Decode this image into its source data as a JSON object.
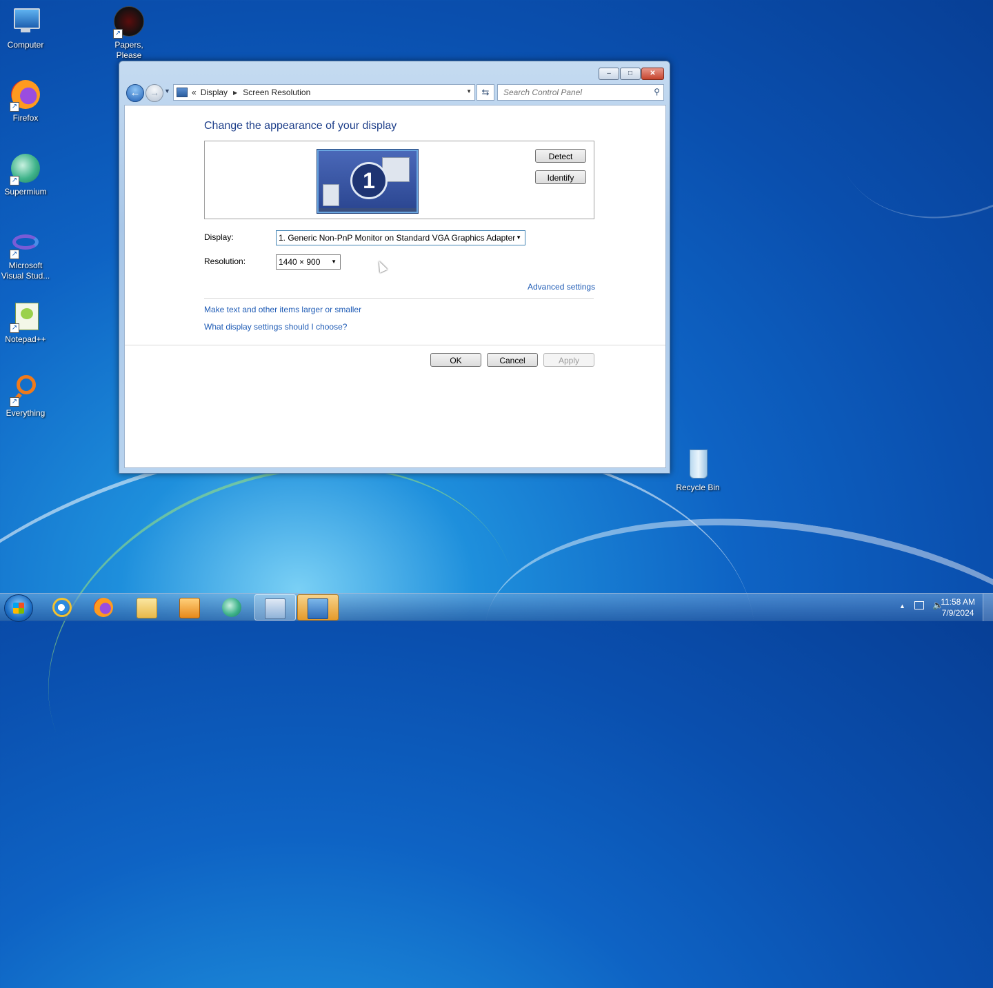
{
  "desktop": {
    "icons": [
      {
        "label": "Computer"
      },
      {
        "label": "Papers, Please"
      },
      {
        "label": "Firefox"
      },
      {
        "label": "Supermium"
      },
      {
        "label": "Microsoft Visual Stud..."
      },
      {
        "label": "Notepad++"
      },
      {
        "label": "Everything"
      },
      {
        "label": "Recycle Bin"
      }
    ]
  },
  "window": {
    "controls": {
      "minimize": "–",
      "maximize": "□",
      "close": "✕"
    },
    "breadcrumb": {
      "prefix": "«",
      "items": [
        "Display",
        "Screen Resolution"
      ]
    },
    "search": {
      "placeholder": "Search Control Panel"
    },
    "heading": "Change the appearance of your display",
    "monitor_number": "1",
    "buttons": {
      "detect": "Detect",
      "identify": "Identify",
      "ok": "OK",
      "cancel": "Cancel",
      "apply": "Apply"
    },
    "display": {
      "label": "Display:",
      "value": "1. Generic Non-PnP Monitor on Standard VGA Graphics Adapter"
    },
    "resolution": {
      "label": "Resolution:",
      "value": "1440 × 900"
    },
    "links": {
      "advanced": "Advanced settings",
      "text_size": "Make text and other items larger or smaller",
      "help": "What display settings should I choose?"
    }
  },
  "taskbar": {
    "clock": {
      "time": "11:58 AM",
      "date": "7/9/2024"
    }
  }
}
